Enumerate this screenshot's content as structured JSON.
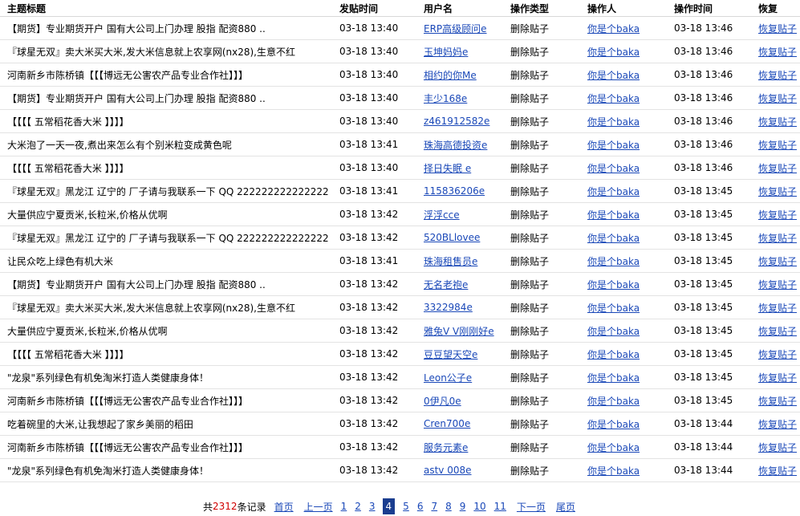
{
  "headers": [
    "主题标题",
    "发贴时间",
    "用户名",
    "操作类型",
    "操作人",
    "操作时间",
    "恢复"
  ],
  "rows": [
    {
      "title": "【期货】专业期货开户 国有大公司上门办理 股指 配资880 ..",
      "post_time": "03-18 13:40",
      "user": "ERP高级顾问e",
      "action": "删除贴子",
      "operator": "你是个baka",
      "op_time": "03-18 13:46",
      "restore": "恢复贴子"
    },
    {
      "title": "『球星无双』卖大米买大米,发大米信息就上农享网(nx28),生意不红",
      "post_time": "03-18 13:40",
      "user": "玉坤妈妈e",
      "action": "删除贴子",
      "operator": "你是个baka",
      "op_time": "03-18 13:46",
      "restore": "恢复贴子"
    },
    {
      "title": "河南新乡市陈桥镇【【【博远无公害农产品专业合作社】】】",
      "post_time": "03-18 13:40",
      "user": "相约的你Me",
      "action": "删除贴子",
      "operator": "你是个baka",
      "op_time": "03-18 13:46",
      "restore": "恢复贴子"
    },
    {
      "title": "【期货】专业期货开户 国有大公司上门办理 股指 配资880 ..",
      "post_time": "03-18 13:40",
      "user": "丰少168e",
      "action": "删除贴子",
      "operator": "你是个baka",
      "op_time": "03-18 13:46",
      "restore": "恢复贴子"
    },
    {
      "title": "【【【【 五常稻花香大米 】】】】",
      "post_time": "03-18 13:40",
      "user": "z461912582e",
      "action": "删除贴子",
      "operator": "你是个baka",
      "op_time": "03-18 13:46",
      "restore": "恢复贴子"
    },
    {
      "title": "大米泡了一天一夜,煮出来怎么有个别米粒变成黄色呢",
      "post_time": "03-18 13:41",
      "user": "珠海高德投资e",
      "action": "删除贴子",
      "operator": "你是个baka",
      "op_time": "03-18 13:46",
      "restore": "恢复贴子"
    },
    {
      "title": "【【【【 五常稻花香大米 】】】】",
      "post_time": "03-18 13:40",
      "user": "择日失眠 e",
      "action": "删除贴子",
      "operator": "你是个baka",
      "op_time": "03-18 13:46",
      "restore": "恢复贴子"
    },
    {
      "title": "『球星无双』黑龙江 辽宁的 厂子请与我联系一下 QQ 222222222222222",
      "post_time": "03-18 13:41",
      "user": "115836206e",
      "action": "删除贴子",
      "operator": "你是个baka",
      "op_time": "03-18 13:45",
      "restore": "恢复贴子"
    },
    {
      "title": "大量供应宁夏贡米,长粒米,价格从优啊",
      "post_time": "03-18 13:42",
      "user": "浮浮cce",
      "action": "删除贴子",
      "operator": "你是个baka",
      "op_time": "03-18 13:45",
      "restore": "恢复贴子"
    },
    {
      "title": "『球星无双』黑龙江 辽宁的 厂子请与我联系一下 QQ 222222222222222",
      "post_time": "03-18 13:42",
      "user": "520BLlovee",
      "action": "删除贴子",
      "operator": "你是个baka",
      "op_time": "03-18 13:45",
      "restore": "恢复贴子"
    },
    {
      "title": "让民众吃上绿色有机大米",
      "post_time": "03-18 13:41",
      "user": "珠海租售员e",
      "action": "删除贴子",
      "operator": "你是个baka",
      "op_time": "03-18 13:45",
      "restore": "恢复贴子"
    },
    {
      "title": "【期货】专业期货开户 国有大公司上门办理 股指 配资880 ..",
      "post_time": "03-18 13:42",
      "user": "无名老袍e",
      "action": "删除贴子",
      "operator": "你是个baka",
      "op_time": "03-18 13:45",
      "restore": "恢复贴子"
    },
    {
      "title": "『球星无双』卖大米买大米,发大米信息就上农享网(nx28),生意不红",
      "post_time": "03-18 13:42",
      "user": "3322984e",
      "action": "删除贴子",
      "operator": "你是个baka",
      "op_time": "03-18 13:45",
      "restore": "恢复贴子"
    },
    {
      "title": "大量供应宁夏贡米,长粒米,价格从优啊",
      "post_time": "03-18 13:42",
      "user": "雅兔V V刚刚好e",
      "action": "删除贴子",
      "operator": "你是个baka",
      "op_time": "03-18 13:45",
      "restore": "恢复贴子"
    },
    {
      "title": "【【【【 五常稻花香大米 】】】】",
      "post_time": "03-18 13:42",
      "user": "豆豆望天空e",
      "action": "删除贴子",
      "operator": "你是个baka",
      "op_time": "03-18 13:45",
      "restore": "恢复贴子"
    },
    {
      "title": "\"龙泉\"系列绿色有机免淘米打造人类健康身体！",
      "post_time": "03-18 13:42",
      "user": "Leon公子e",
      "action": "删除贴子",
      "operator": "你是个baka",
      "op_time": "03-18 13:45",
      "restore": "恢复贴子"
    },
    {
      "title": "河南新乡市陈桥镇【【【博远无公害农产品专业合作社】】】",
      "post_time": "03-18 13:42",
      "user": "0伊凡0e",
      "action": "删除贴子",
      "operator": "你是个baka",
      "op_time": "03-18 13:45",
      "restore": "恢复贴子"
    },
    {
      "title": "吃着碗里的大米,让我想起了家乡美丽的稻田",
      "post_time": "03-18 13:42",
      "user": "Cren700e",
      "action": "删除贴子",
      "operator": "你是个baka",
      "op_time": "03-18 13:44",
      "restore": "恢复贴子"
    },
    {
      "title": "河南新乡市陈桥镇【【【博远无公害农产品专业合作社】】】",
      "post_time": "03-18 13:42",
      "user": "服务元素e",
      "action": "删除贴子",
      "operator": "你是个baka",
      "op_time": "03-18 13:44",
      "restore": "恢复贴子"
    },
    {
      "title": "\"龙泉\"系列绿色有机免淘米打造人类健康身体！",
      "post_time": "03-18 13:42",
      "user": "astv 008e",
      "action": "删除贴子",
      "operator": "你是个baka",
      "op_time": "03-18 13:44",
      "restore": "恢复贴子"
    }
  ],
  "pagination": {
    "total_prefix": "共",
    "total_count": "2312",
    "total_suffix": "条记录",
    "first": "首页",
    "prev": "上一页",
    "pages_before": [
      "1",
      "2",
      "3"
    ],
    "current": "4",
    "pages_after": [
      "5",
      "6",
      "7",
      "8",
      "9",
      "10",
      "11"
    ],
    "next": "下一页",
    "last": "尾页"
  },
  "colors": {
    "link": "#1a48b8",
    "total_count": "#d00000",
    "current_page_bg": "#1a3d8f"
  }
}
